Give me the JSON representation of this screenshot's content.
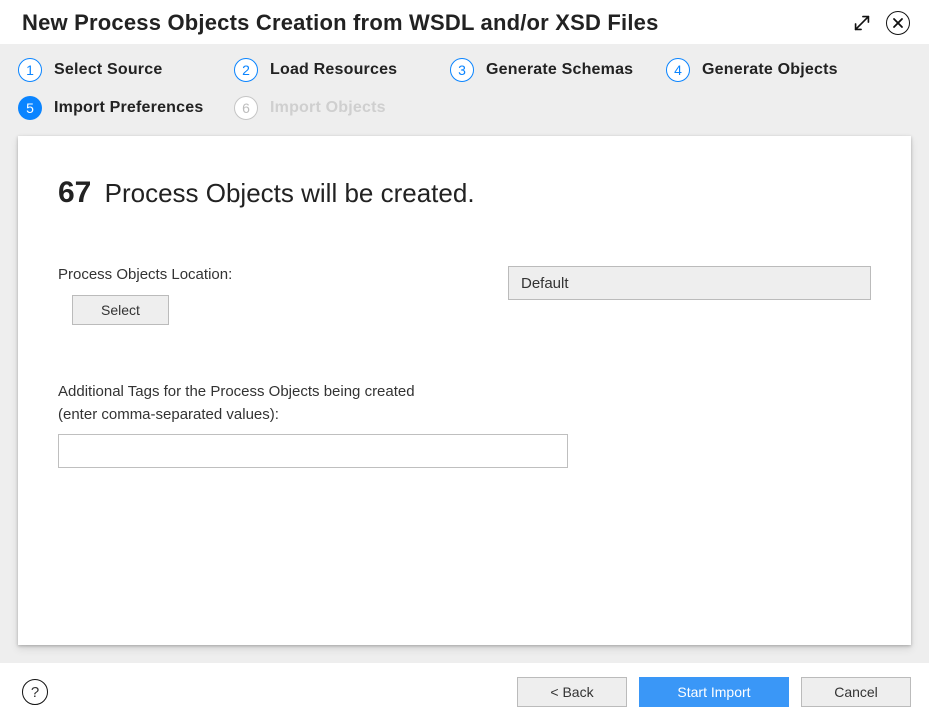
{
  "title": "New Process Objects Creation from WSDL and/or XSD Files",
  "steps": [
    {
      "num": "1",
      "label": "Select Source",
      "state": "outline"
    },
    {
      "num": "2",
      "label": "Load Resources",
      "state": "outline"
    },
    {
      "num": "3",
      "label": "Generate Schemas",
      "state": "outline"
    },
    {
      "num": "4",
      "label": "Generate Objects",
      "state": "outline"
    },
    {
      "num": "5",
      "label": "Import Preferences",
      "state": "filled"
    },
    {
      "num": "6",
      "label": "Import Objects",
      "state": "disabled"
    }
  ],
  "content": {
    "count": "67",
    "headline_rest": "Process Objects will be created.",
    "location_label": "Process Objects Location:",
    "location_value": "Default",
    "select_button": "Select",
    "tags_label_line1": "Additional Tags for the Process Objects being created",
    "tags_label_line2": "(enter comma-separated values):",
    "tags_value": ""
  },
  "footer": {
    "help": "?",
    "back": "< Back",
    "start": "Start Import",
    "cancel": "Cancel"
  }
}
